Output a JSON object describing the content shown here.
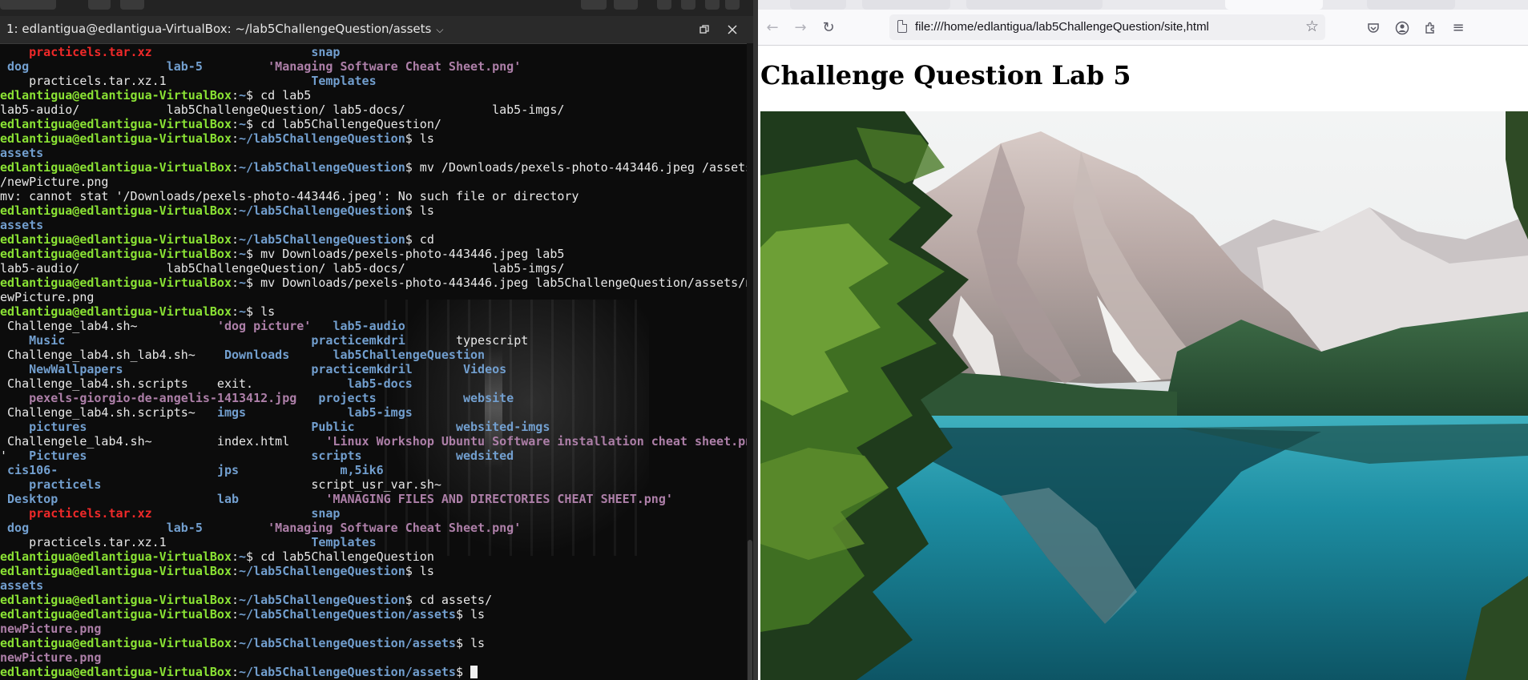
{
  "terminal": {
    "title": "1: edlantigua@edlantigua-VirtualBox: ~/lab5ChallengeQuestion/assets",
    "lines": [
      [
        [
          "    ",
          ""
        ],
        [
          "practicels.tar.xz",
          "c-red"
        ],
        [
          "                      ",
          ""
        ],
        [
          "snap",
          "c-dir"
        ]
      ],
      [
        [
          " ",
          ""
        ],
        [
          "dog",
          "c-dir"
        ],
        [
          "                   ",
          ""
        ],
        [
          "lab-5",
          "c-dir"
        ],
        [
          "         ",
          ""
        ],
        [
          "'Managing Software Cheat Sheet.png'",
          "c-str"
        ]
      ],
      [
        [
          "    practicels.tar.xz.1                    ",
          ""
        ],
        [
          "Templates",
          "c-dir"
        ]
      ],
      [
        [
          "edlantigua@edlantigua-VirtualBox",
          "c-user"
        ],
        [
          ":",
          ""
        ],
        [
          "~",
          "c-path"
        ],
        [
          "$ cd lab5",
          ""
        ]
      ],
      [
        [
          "lab5-audio/            lab5ChallengeQuestion/ lab5-docs/            lab5-imgs/",
          ""
        ]
      ],
      [
        [
          "edlantigua@edlantigua-VirtualBox",
          "c-user"
        ],
        [
          ":",
          ""
        ],
        [
          "~",
          "c-path"
        ],
        [
          "$ cd lab5ChallengeQuestion/",
          ""
        ]
      ],
      [
        [
          "edlantigua@edlantigua-VirtualBox",
          "c-user"
        ],
        [
          ":",
          ""
        ],
        [
          "~/lab5ChallengeQuestion",
          "c-path"
        ],
        [
          "$ ls",
          ""
        ]
      ],
      [
        [
          "assets",
          "c-dir"
        ]
      ],
      [
        [
          "edlantigua@edlantigua-VirtualBox",
          "c-user"
        ],
        [
          ":",
          ""
        ],
        [
          "~/lab5ChallengeQuestion",
          "c-path"
        ],
        [
          "$ mv /Downloads/pexels-photo-443446.jpeg /assets",
          ""
        ]
      ],
      [
        [
          "/newPicture.png",
          ""
        ]
      ],
      [
        [
          "mv: cannot stat '/Downloads/pexels-photo-443446.jpeg': No such file or directory",
          ""
        ]
      ],
      [
        [
          "edlantigua@edlantigua-VirtualBox",
          "c-user"
        ],
        [
          ":",
          ""
        ],
        [
          "~/lab5ChallengeQuestion",
          "c-path"
        ],
        [
          "$ ls",
          ""
        ]
      ],
      [
        [
          "assets",
          "c-dir"
        ]
      ],
      [
        [
          "edlantigua@edlantigua-VirtualBox",
          "c-user"
        ],
        [
          ":",
          ""
        ],
        [
          "~/lab5ChallengeQuestion",
          "c-path"
        ],
        [
          "$ cd",
          ""
        ]
      ],
      [
        [
          "edlantigua@edlantigua-VirtualBox",
          "c-user"
        ],
        [
          ":",
          ""
        ],
        [
          "~",
          "c-path"
        ],
        [
          "$ mv Downloads/pexels-photo-443446.jpeg lab5",
          ""
        ]
      ],
      [
        [
          "lab5-audio/            lab5ChallengeQuestion/ lab5-docs/            lab5-imgs/",
          ""
        ]
      ],
      [
        [
          "edlantigua@edlantigua-VirtualBox",
          "c-user"
        ],
        [
          ":",
          ""
        ],
        [
          "~",
          "c-path"
        ],
        [
          "$ mv Downloads/pexels-photo-443446.jpeg lab5ChallengeQuestion/assets/n",
          ""
        ]
      ],
      [
        [
          "ewPicture.png",
          ""
        ]
      ],
      [
        [
          "edlantigua@edlantigua-VirtualBox",
          "c-user"
        ],
        [
          ":",
          ""
        ],
        [
          "~",
          "c-path"
        ],
        [
          "$ ls",
          ""
        ]
      ],
      [
        [
          " Challenge_lab4.sh~           ",
          ""
        ],
        [
          "'dog picture'",
          "c-str"
        ],
        [
          "   ",
          ""
        ],
        [
          "lab5-audio",
          "c-dir"
        ]
      ],
      [
        [
          "    ",
          ""
        ],
        [
          "Music",
          "c-dir"
        ],
        [
          "                                  ",
          ""
        ],
        [
          "practicemkdri",
          "c-dir"
        ],
        [
          "       typescript",
          ""
        ]
      ],
      [
        [
          " Challenge_lab4.sh_lab4.sh~    ",
          ""
        ],
        [
          "Downloads",
          "c-dir"
        ],
        [
          "      ",
          ""
        ],
        [
          "lab5ChallengeQuestion",
          "c-dir"
        ]
      ],
      [
        [
          "    ",
          ""
        ],
        [
          "NewWallpapers",
          "c-dir"
        ],
        [
          "                          ",
          ""
        ],
        [
          "practicemkdril",
          "c-dir"
        ],
        [
          "       ",
          ""
        ],
        [
          "Videos",
          "c-dir"
        ]
      ],
      [
        [
          " Challenge_lab4.sh.scripts    exit.             ",
          ""
        ],
        [
          "lab5-docs",
          "c-dir"
        ]
      ],
      [
        [
          "    ",
          ""
        ],
        [
          "pexels-giorgio-de-angelis-1413412.jpg",
          "c-img"
        ],
        [
          "   ",
          ""
        ],
        [
          "projects",
          "c-dir"
        ],
        [
          "            ",
          ""
        ],
        [
          "website",
          "c-dir"
        ]
      ],
      [
        [
          " Challenge_lab4.sh.scripts~   ",
          ""
        ],
        [
          "imgs",
          "c-dir"
        ],
        [
          "              ",
          ""
        ],
        [
          "lab5-imgs",
          "c-dir"
        ]
      ],
      [
        [
          "    ",
          ""
        ],
        [
          "pictures",
          "c-dir"
        ],
        [
          "                               ",
          ""
        ],
        [
          "Public",
          "c-dir"
        ],
        [
          "              ",
          ""
        ],
        [
          "websited-imgs",
          "c-dir"
        ]
      ],
      [
        [
          " Challengele_lab4.sh~         index.html     ",
          ""
        ],
        [
          "'Linux Workshop Ubuntu Software installation cheat sheet.png",
          "c-str"
        ]
      ],
      [
        [
          "'   ",
          ""
        ],
        [
          "Pictures",
          "c-dir"
        ],
        [
          "                               ",
          ""
        ],
        [
          "scripts",
          "c-dir"
        ],
        [
          "             ",
          ""
        ],
        [
          "wedsited",
          "c-dir"
        ]
      ],
      [
        [
          " ",
          ""
        ],
        [
          "cis106-",
          "c-dir"
        ],
        [
          "                      ",
          ""
        ],
        [
          "jps",
          "c-dir"
        ],
        [
          "              ",
          ""
        ],
        [
          "m,5ik6",
          "c-dir"
        ]
      ],
      [
        [
          "    ",
          ""
        ],
        [
          "practicels",
          "c-dir"
        ],
        [
          "                             script_usr_var.sh~",
          ""
        ]
      ],
      [
        [
          " ",
          ""
        ],
        [
          "Desktop",
          "c-dir"
        ],
        [
          "                      ",
          ""
        ],
        [
          "lab",
          "c-dir"
        ],
        [
          "            ",
          ""
        ],
        [
          "'MANAGING FILES AND DIRECTORIES CHEAT SHEET.png'",
          "c-str"
        ]
      ],
      [
        [
          "    ",
          ""
        ],
        [
          "practicels.tar.xz",
          "c-red"
        ],
        [
          "                      ",
          ""
        ],
        [
          "snap",
          "c-dir"
        ]
      ],
      [
        [
          " ",
          ""
        ],
        [
          "dog",
          "c-dir"
        ],
        [
          "                   ",
          ""
        ],
        [
          "lab-5",
          "c-dir"
        ],
        [
          "         ",
          ""
        ],
        [
          "'Managing Software Cheat Sheet.png'",
          "c-str"
        ]
      ],
      [
        [
          "    practicels.tar.xz.1                    ",
          ""
        ],
        [
          "Templates",
          "c-dir"
        ]
      ],
      [
        [
          "edlantigua@edlantigua-VirtualBox",
          "c-user"
        ],
        [
          ":",
          ""
        ],
        [
          "~",
          "c-path"
        ],
        [
          "$ cd lab5ChallengeQuestion",
          ""
        ]
      ],
      [
        [
          "edlantigua@edlantigua-VirtualBox",
          "c-user"
        ],
        [
          ":",
          ""
        ],
        [
          "~/lab5ChallengeQuestion",
          "c-path"
        ],
        [
          "$ ls",
          ""
        ]
      ],
      [
        [
          "assets",
          "c-dir"
        ]
      ],
      [
        [
          "edlantigua@edlantigua-VirtualBox",
          "c-user"
        ],
        [
          ":",
          ""
        ],
        [
          "~/lab5ChallengeQuestion",
          "c-path"
        ],
        [
          "$ cd assets/",
          ""
        ]
      ],
      [
        [
          "edlantigua@edlantigua-VirtualBox",
          "c-user"
        ],
        [
          ":",
          ""
        ],
        [
          "~/lab5ChallengeQuestion/assets",
          "c-path"
        ],
        [
          "$ ls",
          ""
        ]
      ],
      [
        [
          "newPicture.png",
          "c-img"
        ]
      ],
      [
        [
          "edlantigua@edlantigua-VirtualBox",
          "c-user"
        ],
        [
          ":",
          ""
        ],
        [
          "~/lab5ChallengeQuestion/assets",
          "c-path"
        ],
        [
          "$ ls",
          ""
        ]
      ],
      [
        [
          "newPicture.png",
          "c-img"
        ]
      ],
      [
        [
          "edlantigua@edlantigua-VirtualBox",
          "c-user"
        ],
        [
          ":",
          ""
        ],
        [
          "~/lab5ChallengeQuestion/assets",
          "c-path"
        ],
        [
          "$ ",
          ""
        ]
      ]
    ]
  },
  "browser": {
    "url": "file:///home/edlantigua/lab5ChallengeQuestion/site,html",
    "page_heading": "Challenge Question Lab 5",
    "image_description_icon": "landscape-photo"
  },
  "colors": {
    "terminal_bg": "#0c0c0c",
    "prompt_user": "#8ae234",
    "prompt_path": "#729fcf",
    "archive_red": "#ef2929",
    "quoted_purple": "#ad7fa8"
  }
}
